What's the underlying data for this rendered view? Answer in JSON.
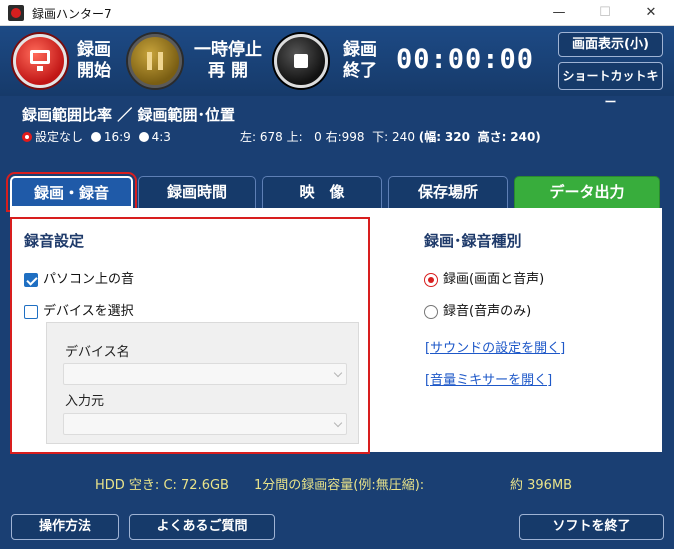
{
  "window": {
    "title": "録画ハンター7",
    "minimize_glyph": "—",
    "maximize_glyph": "☐",
    "close_glyph": "✕"
  },
  "toolbar": {
    "start_line1": "録画",
    "start_line2": "開始",
    "pause_line1": "一時停止",
    "pause_line2": "再 開",
    "end_line1": "録画",
    "end_line2": "終了",
    "timer": "00:00:00",
    "screen_display_label": "画面表示(小)",
    "shortcut_key_label": "ショートカットキー"
  },
  "range": {
    "title": "録画範囲比率 ／ 録画範囲･位置",
    "options": [
      "設定なし",
      "16:9",
      "4:3"
    ],
    "selected_option": "設定なし",
    "left_label": "左:",
    "left_value": "678",
    "top_label": "上:",
    "top_value": "0",
    "right_label": "右:",
    "right_value": "998",
    "bottom_label": "下:",
    "bottom_value": "240",
    "width_label": "(幅:",
    "width_value": "320",
    "height_label": "高さ:",
    "height_value": "240)"
  },
  "tabs": [
    {
      "label": "録画・録音",
      "active": true
    },
    {
      "label": "録画時間"
    },
    {
      "label": "映　像"
    },
    {
      "label": "保存場所"
    },
    {
      "label": "データ出力"
    }
  ],
  "audio_settings": {
    "title": "録音設定",
    "pc_audio_label": "パソコン上の音",
    "pc_audio_checked": true,
    "select_device_label": "デバイスを選択",
    "select_device_checked": false,
    "device_name_label": "デバイス名",
    "input_source_label": "入力元"
  },
  "rec_type": {
    "title": "録画･録音種別",
    "options": [
      "録画(画面と音声)",
      "録音(音声のみ)"
    ],
    "selected": "録画(画面と音声)",
    "sound_settings_link": "[サウンドの設定を開く]",
    "volume_mixer_link": "[音量ミキサーを開く]"
  },
  "footer": {
    "hdd_free": "HDD 空き: C: 72.6GB",
    "per_minute_label": "1分間の録画容量(例:無圧縮):",
    "per_minute_value": "約 396MB",
    "how_to_label": "操作方法",
    "faq_label": "よくあるご質問",
    "exit_label": "ソフトを終了"
  },
  "colors": {
    "background": "#1a3f73",
    "accent_red": "#d81e1e",
    "tab_active": "#1f5aa8",
    "tab_data_output": "#38ad3c",
    "hdd_text": "#e9e38a",
    "link": "#1e58c8"
  }
}
